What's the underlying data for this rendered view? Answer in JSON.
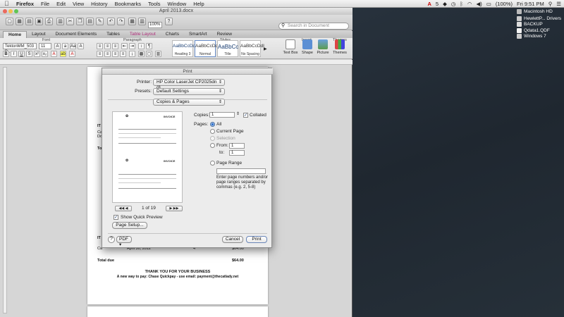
{
  "menubar": {
    "app": "Firefox",
    "items": [
      "File",
      "Edit",
      "View",
      "History",
      "Bookmarks",
      "Tools",
      "Window",
      "Help"
    ],
    "status_badge": "5",
    "battery": "(100%)",
    "clock": "Fri 9:51 PM"
  },
  "desktop": {
    "icons": [
      "Macintosh HD",
      "HewlettP... Drivers",
      "BACKUP",
      "Qdata1.QDF",
      "Windows 7"
    ]
  },
  "word": {
    "title": "April 2013.docx",
    "zoom": "100%",
    "search_placeholder": "Search in Document",
    "tabs": [
      "Home",
      "Layout",
      "Document Elements",
      "Tables",
      "Table Layout",
      "Charts",
      "SmartArt",
      "Review"
    ],
    "groups": {
      "font": "Font",
      "paragraph": "Paragraph",
      "styles": "Styles",
      "insert": "Insert",
      "themes": "Themes"
    },
    "font_name": "TektonMM_503 B...",
    "font_size": "11",
    "styles": [
      {
        "preview": "AaBbCcDdI",
        "name": "Heading 3"
      },
      {
        "preview": "AaBbCcDdI",
        "name": "Normal"
      },
      {
        "preview": "AaBbCc",
        "name": "Title"
      },
      {
        "preview": "AaBbCcDdI",
        "name": "No Spacing"
      }
    ],
    "insert_items": [
      "Text Box",
      "Shape",
      "Picture",
      "Themes"
    ],
    "doc": {
      "it_label": "IT",
      "row_label": "Ca",
      "row_label2": "Do",
      "tot_label": "Tot",
      "it2_label": "IT",
      "row_bottom": "Ca",
      "row_bottom_date": "April 30, 2012",
      "row_bottom_qty": "4",
      "row_bottom_amt": "$64.00",
      "total_due_label": "Total due",
      "total_due_value": "$64.00",
      "thanks": "THANK YOU FOR YOUR BUSINESS",
      "pay_line": "A new way to pay:  Chase Quickpay - use email:  payment@thecatlady.net"
    }
  },
  "print_dialog": {
    "title": "Print",
    "printer_label": "Printer:",
    "printer_value": "HP Color LaserJet CP2025dn (8...",
    "presets_label": "Presets:",
    "presets_value": "Default Settings",
    "section_value": "Copies & Pages",
    "copies_label": "Copies:",
    "copies_value": "1",
    "collated_label": "Collated",
    "pages_label": "Pages:",
    "page_options": [
      "All",
      "Current Page",
      "Selection",
      "From:",
      "Page Range"
    ],
    "from_value": "1",
    "to_label": "to:",
    "to_value": "1",
    "range_help": "Enter page numbers and/or page ranges separated by commas (e.g. 2, 5-8)",
    "page_indicator": "1 of 19",
    "nav_first": "◀◀",
    "nav_prev": "◀",
    "nav_next": "▶",
    "nav_last": "▶▶",
    "show_quick_preview": "Show Quick Preview",
    "page_setup": "Page Setup...",
    "help": "?",
    "pdf": "PDF",
    "cancel": "Cancel",
    "print": "Print",
    "preview_heading": "INVOICE"
  }
}
